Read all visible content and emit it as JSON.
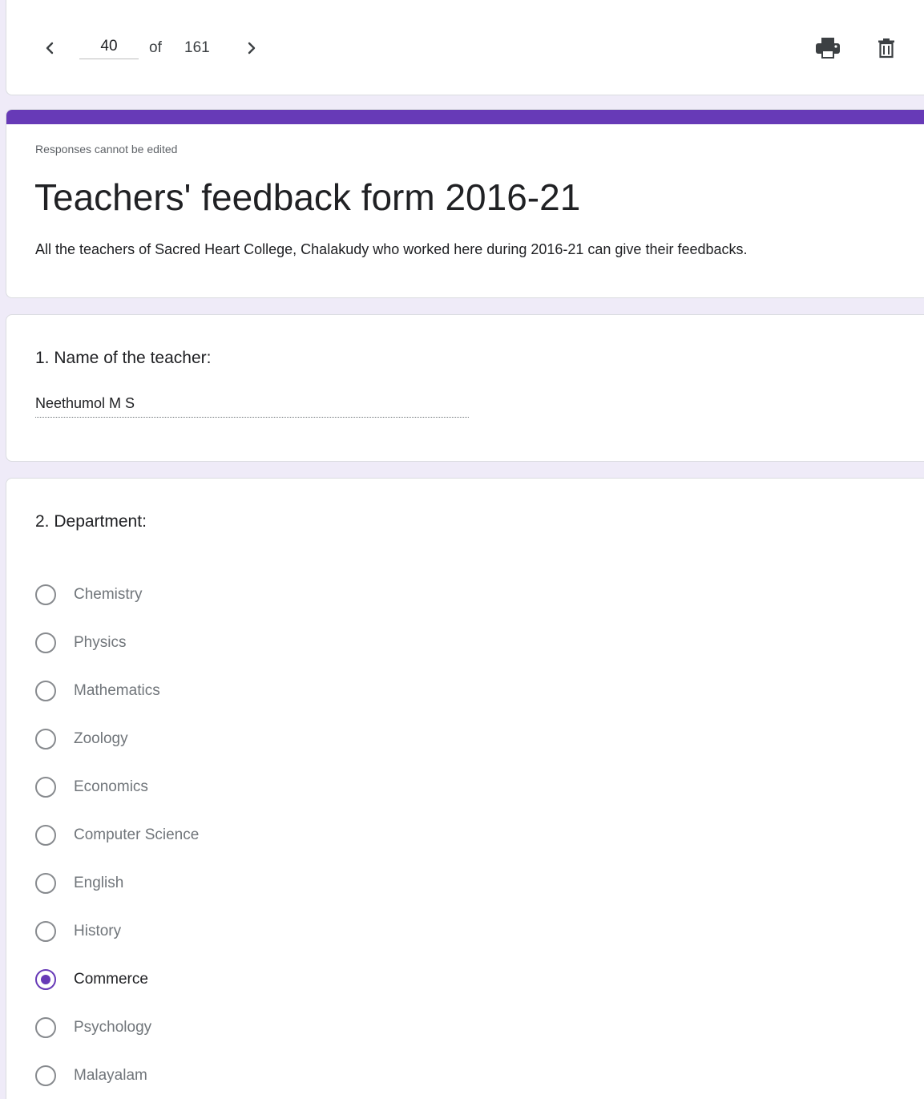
{
  "navigation": {
    "current_page": "40",
    "of_label": "of",
    "total_pages": "161",
    "prev_icon": "chevron-left-icon",
    "next_icon": "chevron-right-icon",
    "print_icon": "print-icon",
    "delete_icon": "trash-icon"
  },
  "header": {
    "notice": "Responses cannot be edited",
    "title": "Teachers' feedback form 2016-21",
    "description": "All the teachers of Sacred Heart College, Chalakudy who worked here during 2016-21 can give their feedbacks.",
    "accent_color": "#673ab7"
  },
  "question1": {
    "title": "1. Name of the teacher:",
    "answer": "Neethumol M S"
  },
  "question2": {
    "title": "2. Department:",
    "options": [
      {
        "label": "Chemistry",
        "selected": false
      },
      {
        "label": "Physics",
        "selected": false
      },
      {
        "label": "Mathematics",
        "selected": false
      },
      {
        "label": "Zoology",
        "selected": false
      },
      {
        "label": "Economics",
        "selected": false
      },
      {
        "label": "Computer Science",
        "selected": false
      },
      {
        "label": "English",
        "selected": false
      },
      {
        "label": "History",
        "selected": false
      },
      {
        "label": "Commerce",
        "selected": true
      },
      {
        "label": "Psychology",
        "selected": false
      },
      {
        "label": "Malayalam",
        "selected": false
      }
    ]
  }
}
